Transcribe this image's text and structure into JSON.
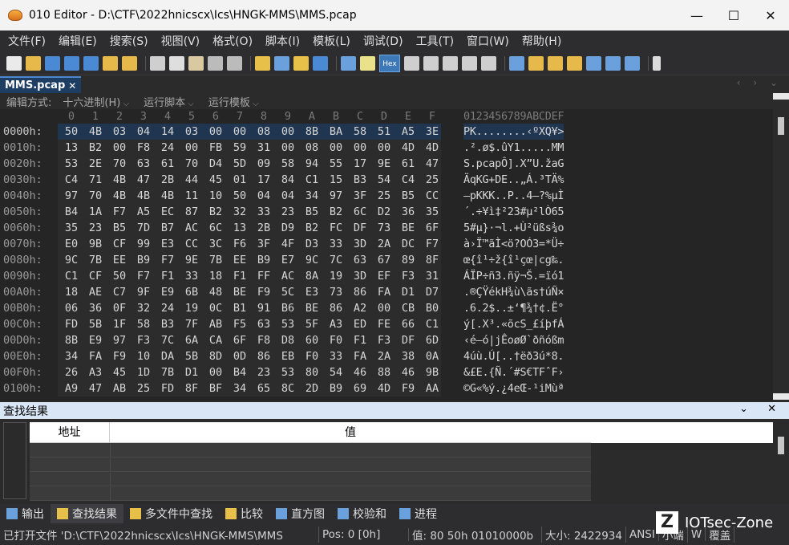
{
  "window": {
    "title": "010 Editor - D:\\CTF\\2022hnicscx\\Ics\\HNGK-MMS\\MMS.pcap",
    "minimize": "—",
    "maximize": "☐",
    "close": "✕"
  },
  "menu": [
    "文件(F)",
    "编辑(E)",
    "搜索(S)",
    "视图(V)",
    "格式(O)",
    "脚本(I)",
    "模板(L)",
    "调试(D)",
    "工具(T)",
    "窗口(W)",
    "帮助(H)"
  ],
  "toolbar": {
    "hex_label": "Hex"
  },
  "tab": {
    "label": "MMS.pcap",
    "close": "✕",
    "nav": "‹ › ⌄"
  },
  "editor_strip": {
    "edit_mode_label": "编辑方式:",
    "edit_mode_value": "十六进制(H)",
    "run_script": "运行脚本",
    "run_template": "运行模板"
  },
  "hex": {
    "column_labels": [
      "0",
      "1",
      "2",
      "3",
      "4",
      "5",
      "6",
      "7",
      "8",
      "9",
      "A",
      "B",
      "C",
      "D",
      "E",
      "F"
    ],
    "ascii_header": "0123456789ABCDEF",
    "rows": [
      {
        "addr": "0000h:",
        "bytes": [
          "50",
          "4B",
          "03",
          "04",
          "14",
          "03",
          "00",
          "00",
          "08",
          "00",
          "8B",
          "BA",
          "58",
          "51",
          "A5",
          "3E"
        ],
        "ascii": "PK........‹ºXQ¥>"
      },
      {
        "addr": "0010h:",
        "bytes": [
          "13",
          "B2",
          "00",
          "F8",
          "24",
          "00",
          "FB",
          "59",
          "31",
          "00",
          "08",
          "00",
          "00",
          "00",
          "4D",
          "4D"
        ],
        "ascii": ".².ø$.ûY1.....MM"
      },
      {
        "addr": "0020h:",
        "bytes": [
          "53",
          "2E",
          "70",
          "63",
          "61",
          "70",
          "D4",
          "5D",
          "09",
          "58",
          "94",
          "55",
          "17",
          "9E",
          "61",
          "47"
        ],
        "ascii": "S.pcapÔ].X”U.žaG"
      },
      {
        "addr": "0030h:",
        "bytes": [
          "C4",
          "71",
          "4B",
          "47",
          "2B",
          "44",
          "45",
          "01",
          "17",
          "84",
          "C1",
          "15",
          "B3",
          "54",
          "C4",
          "25"
        ],
        "ascii": "ÄqKG+DE..„Á.³TÄ%"
      },
      {
        "addr": "0040h:",
        "bytes": [
          "97",
          "70",
          "4B",
          "4B",
          "4B",
          "11",
          "10",
          "50",
          "04",
          "04",
          "34",
          "97",
          "3F",
          "25",
          "B5",
          "CC"
        ],
        "ascii": "—pKKK..P..4—?%µÌ"
      },
      {
        "addr": "0050h:",
        "bytes": [
          "B4",
          "1A",
          "F7",
          "A5",
          "EC",
          "87",
          "B2",
          "32",
          "33",
          "23",
          "B5",
          "B2",
          "6C",
          "D2",
          "36",
          "35"
        ],
        "ascii": "´.÷¥ì‡²23#µ²lÒ65"
      },
      {
        "addr": "0060h:",
        "bytes": [
          "35",
          "23",
          "B5",
          "7D",
          "B7",
          "AC",
          "6C",
          "13",
          "2B",
          "D9",
          "B2",
          "FC",
          "DF",
          "73",
          "BE",
          "6F"
        ],
        "ascii": "5#µ}·¬l.+Ù²üßs¾o"
      },
      {
        "addr": "0070h:",
        "bytes": [
          "E0",
          "9B",
          "CF",
          "99",
          "E3",
          "CC",
          "3C",
          "F6",
          "3F",
          "4F",
          "D3",
          "33",
          "3D",
          "2A",
          "DC",
          "F7"
        ],
        "ascii": "à›Ï™ãÌ<ö?OÓ3=*Ü÷"
      },
      {
        "addr": "0080h:",
        "bytes": [
          "9C",
          "7B",
          "EE",
          "B9",
          "F7",
          "9E",
          "7B",
          "EE",
          "B9",
          "E7",
          "9C",
          "7C",
          "63",
          "67",
          "89",
          "8F"
        ],
        "ascii": "œ{î¹÷ž{î¹çœ|cg‰."
      },
      {
        "addr": "0090h:",
        "bytes": [
          "C1",
          "CF",
          "50",
          "F7",
          "F1",
          "33",
          "18",
          "F1",
          "FF",
          "AC",
          "8A",
          "19",
          "3D",
          "EF",
          "F3",
          "31"
        ],
        "ascii": "ÁÏP÷ñ3.ñÿ¬Š.=ïó1"
      },
      {
        "addr": "00A0h:",
        "bytes": [
          "18",
          "AE",
          "C7",
          "9F",
          "E9",
          "6B",
          "48",
          "BE",
          "F9",
          "5C",
          "E3",
          "73",
          "86",
          "FA",
          "D1",
          "D7"
        ],
        "ascii": ".®ÇŸékH¾ù\\ãs†úÑ×"
      },
      {
        "addr": "00B0h:",
        "bytes": [
          "06",
          "36",
          "0F",
          "32",
          "24",
          "19",
          "0C",
          "B1",
          "91",
          "B6",
          "BE",
          "86",
          "A2",
          "00",
          "CB",
          "B0"
        ],
        "ascii": ".6.2$..±‘¶¾†¢.Ë°"
      },
      {
        "addr": "00C0h:",
        "bytes": [
          "FD",
          "5B",
          "1F",
          "58",
          "B3",
          "7F",
          "AB",
          "F5",
          "63",
          "53",
          "5F",
          "A3",
          "ED",
          "FE",
          "66",
          "C1"
        ],
        "ascii": "ý[.X³.«õcS_£íþfÁ"
      },
      {
        "addr": "00D0h:",
        "bytes": [
          "8B",
          "E9",
          "97",
          "F3",
          "7C",
          "6A",
          "CA",
          "6F",
          "F8",
          "D8",
          "60",
          "F0",
          "F1",
          "F3",
          "DF",
          "6D"
        ],
        "ascii": "‹é—ó|jÊoøØ`ðñóßm"
      },
      {
        "addr": "00E0h:",
        "bytes": [
          "34",
          "FA",
          "F9",
          "10",
          "DA",
          "5B",
          "8D",
          "0D",
          "86",
          "EB",
          "F0",
          "33",
          "FA",
          "2A",
          "38",
          "0A"
        ],
        "ascii": "4úù.Ú[..†ëð3ú*8."
      },
      {
        "addr": "00F0h:",
        "bytes": [
          "26",
          "A3",
          "45",
          "1D",
          "7B",
          "D1",
          "00",
          "B4",
          "23",
          "53",
          "80",
          "54",
          "46",
          "88",
          "46",
          "9B"
        ],
        "ascii": "&£E.{Ñ.´#S€TFˆF›"
      },
      {
        "addr": "0100h:",
        "bytes": [
          "A9",
          "47",
          "AB",
          "25",
          "FD",
          "8F",
          "BF",
          "34",
          "65",
          "8C",
          "2D",
          "B9",
          "69",
          "4D",
          "F9",
          "AA"
        ],
        "ascii": "©G«%ý.¿4eŒ-¹iMùª"
      }
    ]
  },
  "find_panel": {
    "title": "查找结果",
    "buttons": "⌄ ✕",
    "col_address": "地址",
    "col_value": "值"
  },
  "bottom_tabs": [
    "输出",
    "查找结果",
    "多文件中查找",
    "比较",
    "直方图",
    "校验和",
    "进程"
  ],
  "status": {
    "file": "已打开文件 'D:\\CTF\\2022hnicscx\\Ics\\HNGK-MMS\\MMS",
    "pos": "Pos: 0 [0h]",
    "value": "值: 80 50h 01010000b",
    "size": "大小: 2422934",
    "encoding": "ANSI",
    "endian": "小端",
    "mode": "W",
    "insert": "覆盖"
  },
  "watermark": {
    "logo": "Z",
    "text": "IOTsec-Zone"
  }
}
